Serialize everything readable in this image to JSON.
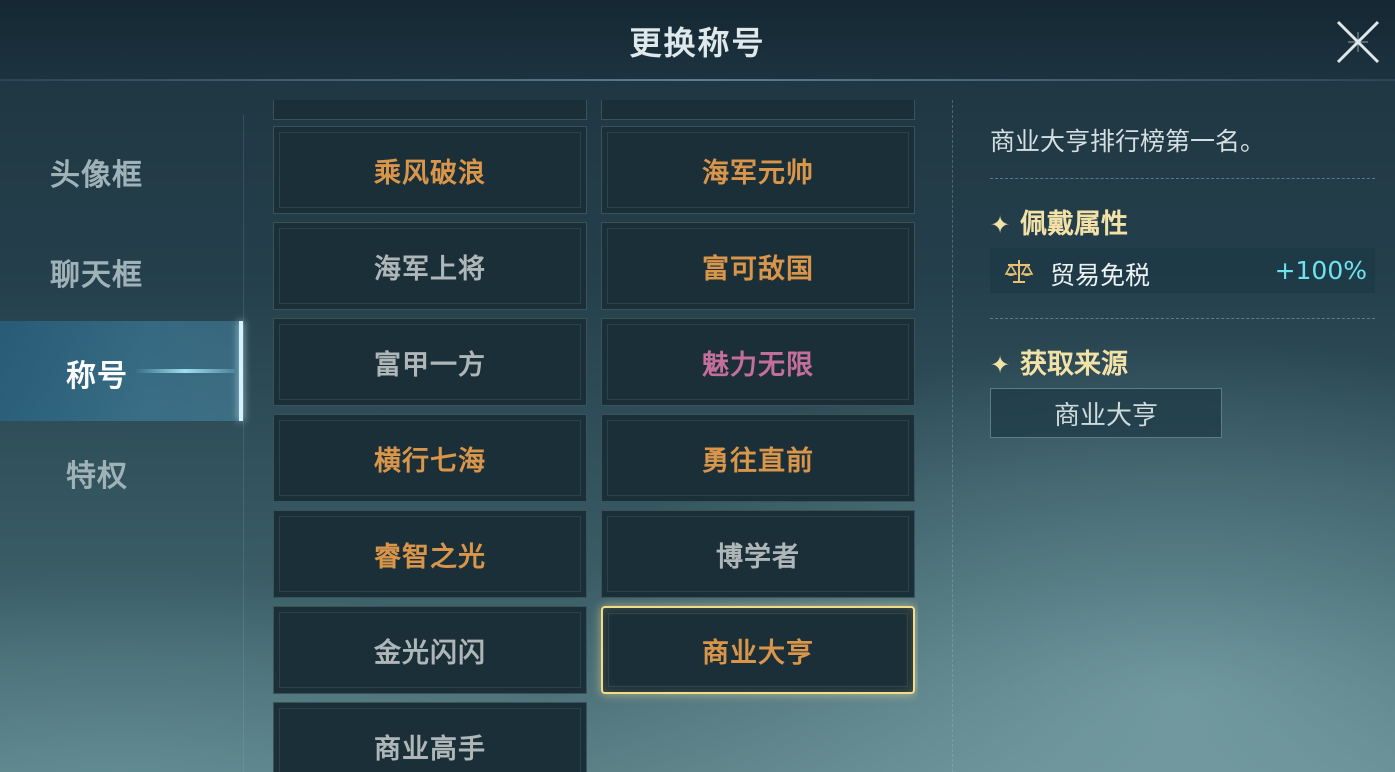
{
  "header": {
    "title": "更换称号",
    "close_icon": "close-x-icon"
  },
  "sidebar": {
    "items": [
      {
        "label": "头像框",
        "active": false
      },
      {
        "label": "聊天框",
        "active": false
      },
      {
        "label": "称号",
        "active": true
      },
      {
        "label": "特权",
        "active": false
      }
    ]
  },
  "titles": {
    "grid": [
      {
        "label": "乘风破浪",
        "color": "gold"
      },
      {
        "label": "海军元帅",
        "color": "gold"
      },
      {
        "label": "海军上将",
        "color": "gray"
      },
      {
        "label": "富可敌国",
        "color": "gold"
      },
      {
        "label": "富甲一方",
        "color": "gray"
      },
      {
        "label": "魅力无限",
        "color": "pink"
      },
      {
        "label": "横行七海",
        "color": "gold"
      },
      {
        "label": "勇往直前",
        "color": "gold"
      },
      {
        "label": "睿智之光",
        "color": "gold"
      },
      {
        "label": "博学者",
        "color": "gray"
      },
      {
        "label": "金光闪闪",
        "color": "gray"
      },
      {
        "label": "商业大亨",
        "color": "gold",
        "selected": true
      },
      {
        "label": "商业高手",
        "color": "gray"
      }
    ],
    "colors": {
      "gold": "#d9954a",
      "gray": "#aeb6b8",
      "pink": "#c46e9a",
      "selected_border": "#f2dc8a"
    }
  },
  "detail": {
    "description": "商业大亨排行榜第一名。",
    "attributes_heading": "佩戴属性",
    "attribute": {
      "icon": "scale-balance-icon",
      "name": "贸易免税",
      "value": "+100%"
    },
    "source_heading": "获取来源",
    "source_button": "商业大亨",
    "heading_icon": "sparkle-star-icon"
  }
}
